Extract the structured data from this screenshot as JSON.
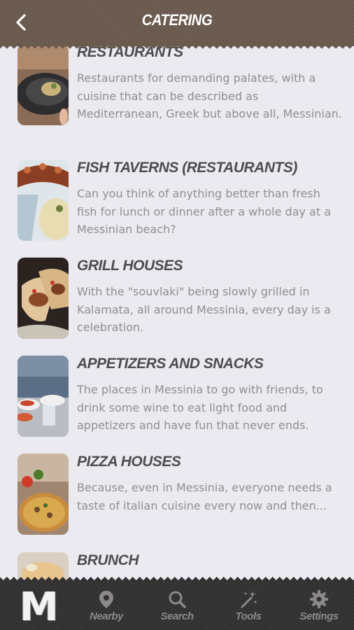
{
  "header": {
    "title": "CATERING"
  },
  "items": [
    {
      "title": "RESTAURANTS",
      "desc": "Restaurants for demanding palates, with a cuisine that can be described as Mediterranean, Greek but above all, Messinian."
    },
    {
      "title": "FISH TAVERNS (RESTAURANTS)",
      "desc": "Can you think of anything better than fresh fish for lunch or dinner after a whole day at a Messinian beach?"
    },
    {
      "title": "GRILL HOUSES",
      "desc": "With the \"souvlaki\" being slowly grilled in Kalamata, all around Messinia, every day is a celebration."
    },
    {
      "title": "APPETIZERS AND SNACKS",
      "desc": "The places in Messinia to go with friends, to drink some wine to eat light food and appetizers and have fun that never ends."
    },
    {
      "title": "PIZZA HOUSES",
      "desc": "Because, even in Messinia, everyone needs a taste of italian cuisine every now and then..."
    },
    {
      "title": "BRUNCH",
      "desc": ""
    }
  ],
  "footer": {
    "logo": "M",
    "tabs": [
      {
        "label": "Nearby",
        "icon": "location-pin-icon"
      },
      {
        "label": "Search",
        "icon": "search-icon"
      },
      {
        "label": "Tools",
        "icon": "magic-wand-icon"
      },
      {
        "label": "Settings",
        "icon": "gear-icon"
      }
    ]
  },
  "colors": {
    "header": "#6b5a4e",
    "footer": "#333131",
    "background": "#ebeaf1",
    "title": "#4d4d4d",
    "desc": "#8f8f8f"
  }
}
